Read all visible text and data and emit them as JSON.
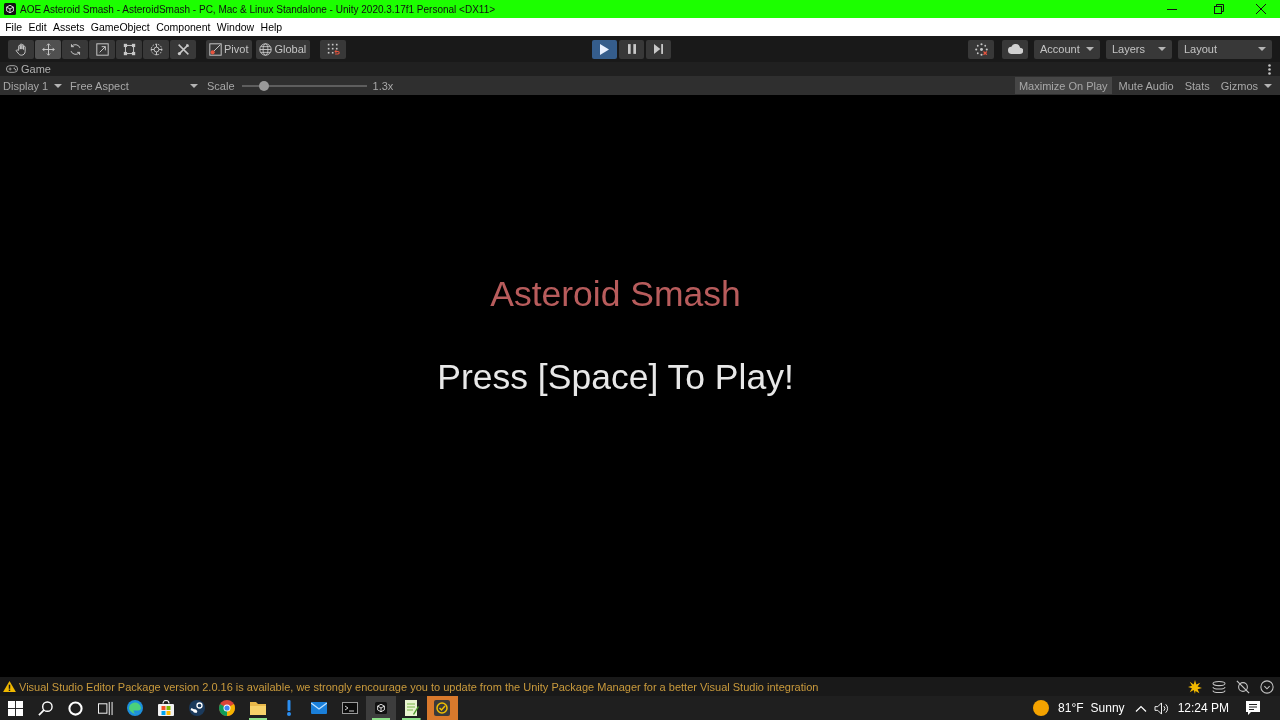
{
  "window": {
    "title": "AOE Asteroid Smash - AsteroidSmash - PC, Mac & Linux Standalone - Unity 2020.3.17f1 Personal <DX11>"
  },
  "menu": [
    "File",
    "Edit",
    "Assets",
    "GameObject",
    "Component",
    "Window",
    "Help"
  ],
  "toolbar": {
    "tools": [
      {
        "kind": "hand",
        "selected": false
      },
      {
        "kind": "move",
        "selected": true
      },
      {
        "kind": "rotate",
        "selected": false
      },
      {
        "kind": "scale",
        "selected": false
      },
      {
        "kind": "rect",
        "selected": false
      },
      {
        "kind": "transform",
        "selected": false
      },
      {
        "kind": "custom",
        "selected": false
      }
    ],
    "pivot_mode": "Pivot",
    "pivot_rotation": "Global",
    "play_controls": [
      {
        "kind": "play",
        "on": true
      },
      {
        "kind": "pause",
        "on": false
      },
      {
        "kind": "step",
        "on": false
      }
    ],
    "dropdowns": [
      "Account",
      "Layers",
      "Layout"
    ]
  },
  "game_view": {
    "tab": "Game",
    "display": "Display 1",
    "aspect": "Free Aspect",
    "scale": {
      "label": "Scale",
      "level": 0.18,
      "reading": "1.3x"
    },
    "options": [
      {
        "label": "Maximize On Play",
        "kind": "toggle",
        "selected": true
      },
      {
        "label": "Mute Audio",
        "kind": "toggle",
        "selected": false
      },
      {
        "label": "Stats",
        "kind": "toggle",
        "selected": false
      },
      {
        "label": "Gizmos",
        "kind": "dropdown",
        "selected": false
      }
    ],
    "title": "Asteroid Smash",
    "prompt": "Press [Space] To Play!"
  },
  "console_message": "Visual Studio Editor Package version 2.0.16 is available, we strongly encourage you to update from the Unity Package Manager for a better Visual Studio integration",
  "taskbar": {
    "apps": [
      {
        "kind": "edge",
        "running": false,
        "selected": false,
        "flashing": false
      },
      {
        "kind": "store",
        "running": false,
        "selected": false,
        "flashing": false
      },
      {
        "kind": "steam",
        "running": false,
        "selected": false,
        "flashing": false
      },
      {
        "kind": "chrome",
        "running": false,
        "selected": false,
        "flashing": false
      },
      {
        "kind": "folder",
        "running": true,
        "selected": false,
        "flashing": false
      },
      {
        "kind": "alert",
        "running": false,
        "selected": false,
        "flashing": false
      },
      {
        "kind": "mail",
        "running": false,
        "selected": false,
        "flashing": false
      },
      {
        "kind": "terminal",
        "running": false,
        "selected": false,
        "flashing": false
      },
      {
        "kind": "unity",
        "running": true,
        "selected": true,
        "flashing": false
      },
      {
        "kind": "notepad",
        "running": true,
        "selected": false,
        "flashing": false
      },
      {
        "kind": "tasks",
        "running": false,
        "selected": false,
        "flashing": true
      }
    ],
    "weather": {
      "temperature": "81°F",
      "condition": "Sunny"
    },
    "clock": "12:24 PM"
  }
}
